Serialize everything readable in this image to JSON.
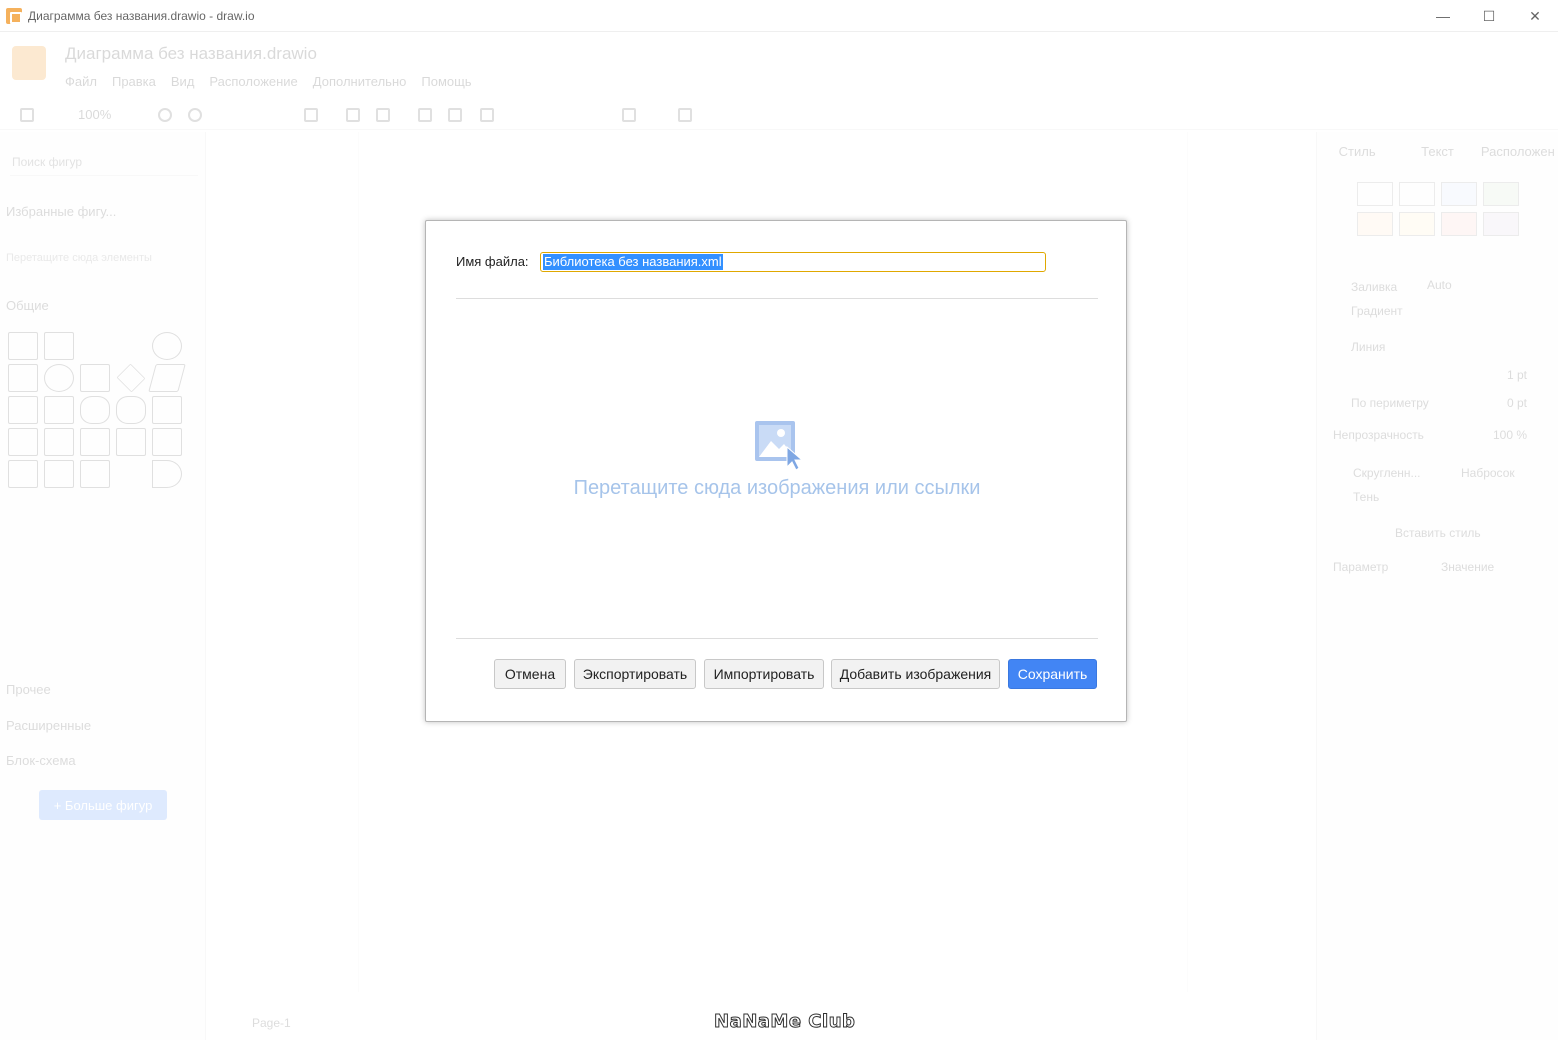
{
  "window": {
    "title": "Диаграмма без названия.drawio - draw.io",
    "minimize": "—",
    "maximize": "☐",
    "close": "✕"
  },
  "app": {
    "doc_title": "Диаграмма без названия.drawio",
    "menu": [
      "Файл",
      "Правка",
      "Вид",
      "Расположение",
      "Дополнительно",
      "Помощь"
    ],
    "zoom": "100%",
    "sidebar": {
      "search_placeholder": "Поиск фигур",
      "favorites": "Избранные фигу...",
      "favorites_hint": "Перетащите сюда элементы",
      "general": "Общие",
      "other": "Прочее",
      "advanced": "Расширенные",
      "flowchart": "Блок-схема",
      "more_shapes": "+ Больше фигур"
    },
    "right_panel": {
      "tabs": [
        "Стиль",
        "Текст",
        "Расположен"
      ],
      "fill": "Заливка",
      "fill_value": "Auto",
      "gradient": "Градиент",
      "line": "Линия",
      "line_width": "1 pt",
      "perimeter": "По периметру",
      "perimeter_value": "0 pt",
      "opacity": "Непрозрачность",
      "opacity_value": "100 %",
      "rounded": "Скругленн...",
      "sketch": "Набросок",
      "shadow": "Тень",
      "paste_style": "Вставить стиль",
      "param_col": "Параметр",
      "value_col": "Значение"
    },
    "page_tab": "Page-1"
  },
  "dialog": {
    "filename_label": "Имя файла:",
    "filename_value": "Библиотека без названия.xml",
    "drop_text": "Перетащите сюда изображения или ссылки",
    "buttons": {
      "cancel": "Отмена",
      "export": "Экспортировать",
      "import": "Импортировать",
      "add_images": "Добавить изображения",
      "save": "Сохранить"
    }
  },
  "watermark": "NaNaMe Club",
  "colors": {
    "accent": "#4285f4",
    "input_border": "#e0a800",
    "selection": "#3390ff",
    "drop_text": "#a6c4ea"
  }
}
